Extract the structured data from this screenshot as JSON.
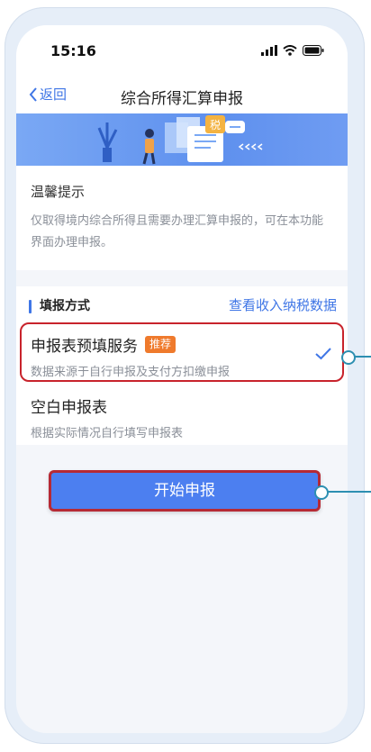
{
  "status_bar": {
    "time": "15:16"
  },
  "nav": {
    "back_label": "返回",
    "title": "综合所得汇算申报"
  },
  "banner": {
    "badge_text": "税"
  },
  "tip": {
    "title": "温馨提示",
    "text": "仅取得境内综合所得且需要办理汇算申报的，可在本功能界面办理申报。"
  },
  "method": {
    "section_label": "填报方式",
    "link_label": "查看收入纳税数据",
    "options": [
      {
        "title": "申报表预填服务",
        "badge": "推荐",
        "subtitle": "数据来源于自行申报及支付方扣缴申报",
        "selected": true
      },
      {
        "title": "空白申报表",
        "subtitle": "根据实际情况自行填写申报表",
        "selected": false
      }
    ]
  },
  "start_button": {
    "label": "开始申报"
  },
  "colors": {
    "accent": "#3f76e6",
    "badge": "#ef7a2c",
    "highlight": "#c8232c",
    "callout": "#2d8fb1"
  }
}
